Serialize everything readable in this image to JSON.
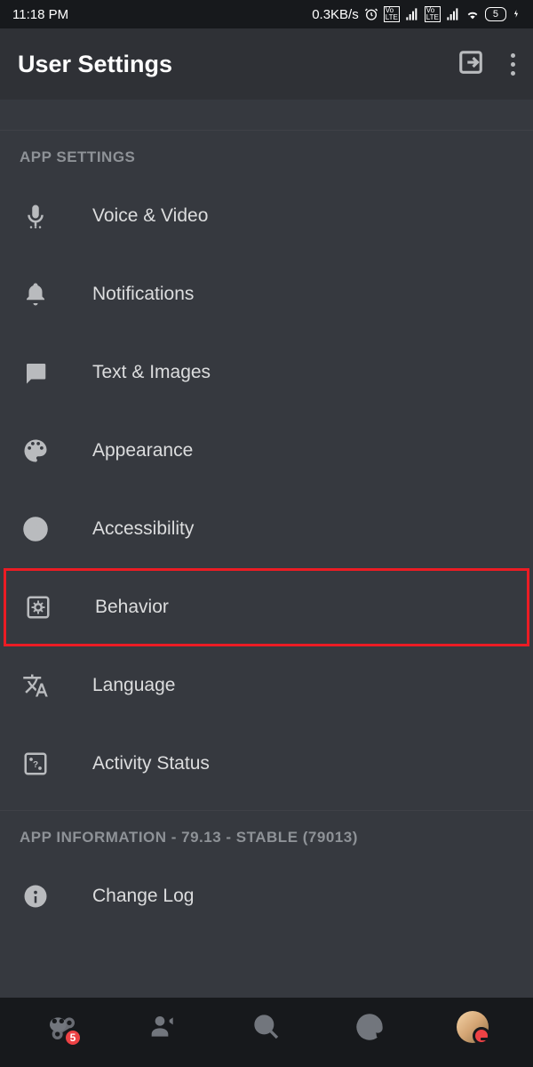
{
  "status_bar": {
    "time": "11:18 PM",
    "data_rate": "0.3KB/s",
    "battery_level": "5"
  },
  "header": {
    "title": "User Settings"
  },
  "sections": {
    "app_settings": {
      "title": "APP SETTINGS",
      "items": [
        {
          "icon": "microphone-icon",
          "label": "Voice & Video"
        },
        {
          "icon": "bell-icon",
          "label": "Notifications"
        },
        {
          "icon": "image-icon",
          "label": "Text & Images"
        },
        {
          "icon": "palette-icon",
          "label": "Appearance"
        },
        {
          "icon": "accessibility-icon",
          "label": "Accessibility"
        },
        {
          "icon": "gear-box-icon",
          "label": "Behavior",
          "highlighted": true
        },
        {
          "icon": "language-icon",
          "label": "Language"
        },
        {
          "icon": "dice-icon",
          "label": "Activity Status"
        }
      ]
    },
    "app_info": {
      "title": "APP INFORMATION - 79.13 - STABLE (79013)",
      "items": [
        {
          "icon": "info-icon",
          "label": "Change Log"
        }
      ]
    }
  },
  "bottom_nav": {
    "badge_count": "5"
  }
}
